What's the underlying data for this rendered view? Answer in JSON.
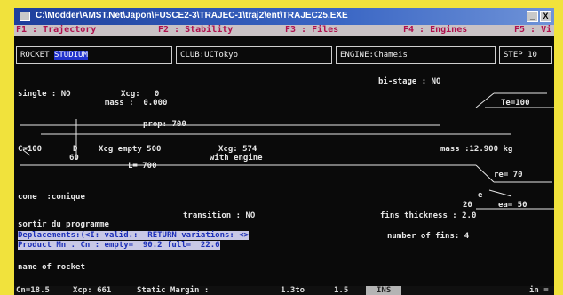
{
  "window": {
    "title": "C:\\Modder\\AMST.Net\\Japon\\FUSCE2-3\\TRAJEC-1\\traj2\\ent\\TRAJEC25.EXE",
    "buttons": [
      "_",
      "X"
    ]
  },
  "menu": [
    "F1 : Trajectory",
    "F2 : Stability",
    "F3 : Files",
    "F4 : Engines",
    "F5 : Vi"
  ],
  "toolbar": {
    "rocket_label": "ROCKET",
    "rocket_value": "STUDIUM",
    "club": "CLUB:UCTokyo",
    "engine": "ENGINE:Chameis",
    "step": "STEP 10"
  },
  "main": {
    "single_stage": "single : NO",
    "xcg": "Xcg:   0",
    "mass": "mass :  0.000",
    "bi_stage": "bi-stage : NO",
    "prop": "prop: 700",
    "cm": "C=100",
    "d": "D",
    "d_value": "60",
    "xcg_empty": "Xcg empty 500",
    "xcg_engine": "Xcg: 574",
    "with_engine": "with engine",
    "l": "L= 700",
    "mass_total": "mass :12.900 kg",
    "te": "Te=100",
    "re": "re= 70",
    "e": "e",
    "e20": "20",
    "ea": "ea= 50",
    "cone": "cone  :conique",
    "transition": "transition : NO",
    "fins_thickness": "fins thickness : 2.0",
    "number_of_fins": "number of fins: 4",
    "sortir": "sortir du programme",
    "deplacements": "Deplacements:(<I: valid.:  RETURN variations: <>",
    "product": "Product Mn . Cn : empty=  90.2 full=  22.6",
    "name_of_rocket": "name of rocket"
  },
  "status": {
    "cn": "Cn=18.5",
    "xcp": "Xcp: 661",
    "static_margin": "Static Margin :",
    "v1": "1.3to",
    "v2": "1.5",
    "ins": "INS",
    "right": "in ="
  }
}
